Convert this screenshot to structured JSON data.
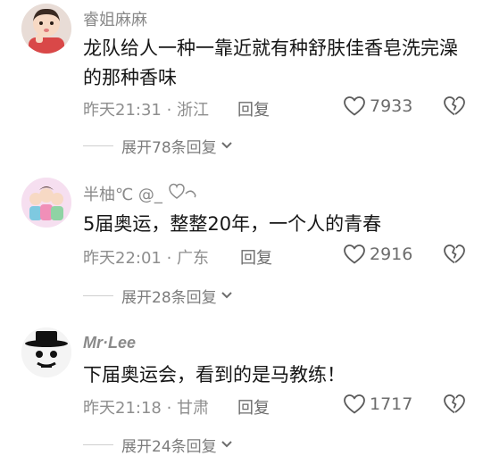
{
  "comments": [
    {
      "username": "睿姐麻麻",
      "text": "龙队给人一种一靠近就有种舒肤佳香皂洗完澡的那种香味",
      "meta": "昨天21:31 · 浙江",
      "reply_label": "回复",
      "likes": "7933",
      "expand_label": "展开78条回复"
    },
    {
      "username": "半柚℃ @_",
      "text": "5届奥运，整整20年，一个人的青春",
      "meta": "昨天22:01 · 广东",
      "reply_label": "回复",
      "likes": "2916",
      "expand_label": "展开28条回复"
    },
    {
      "username": "Mr·Lee",
      "text": "下届奥运会，看到的是马教练！",
      "meta": "昨天21:18 · 甘肃",
      "reply_label": "回复",
      "likes": "1717",
      "expand_label": "展开24条回复"
    }
  ],
  "icons": {
    "like": "heart-outline-icon",
    "dislike": "broken-heart-icon",
    "expand": "chevron-down-icon"
  }
}
